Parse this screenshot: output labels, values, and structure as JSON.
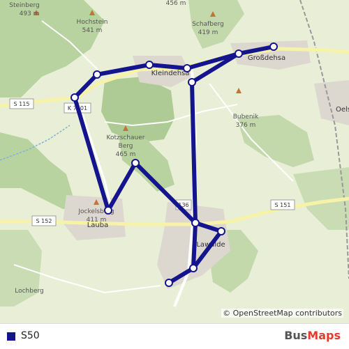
{
  "map": {
    "places": [
      {
        "id": "steinberg",
        "name": "Steinberg",
        "elev": "493 m"
      },
      {
        "id": "hochstein",
        "name": "Hochstein",
        "elev": "541 m"
      },
      {
        "id": "top456",
        "name": "",
        "elev": "456 m"
      },
      {
        "id": "schafberg",
        "name": "Schafberg",
        "elev": "419 m"
      },
      {
        "id": "bubenik",
        "name": "Bubenik",
        "elev": "376 m"
      },
      {
        "id": "kotzschauer",
        "name": "Kotzschauer Berg",
        "elev": "465 m"
      },
      {
        "id": "jockelsberg",
        "name": "Jockelsberg",
        "elev": "411 m"
      }
    ],
    "towns": {
      "kleindehsa": "Kleindehsa",
      "grossdehsa": "Großdehsa",
      "oels": "Oels",
      "lauba": "Lauba",
      "lawalde": "Lawalde",
      "lochberg": "Lochberg"
    },
    "road_labels": {
      "s115": "S 115",
      "k": "K 7201",
      "s152": "S 152",
      "s151": "S 151",
      "n136": "136"
    },
    "route_color": "#14148c",
    "attribution": "© OpenStreetMap contributors"
  },
  "legend": {
    "route_name": "S50",
    "route_color": "#14148c"
  },
  "brand": {
    "bus": "Bus",
    "maps": "Maps"
  }
}
